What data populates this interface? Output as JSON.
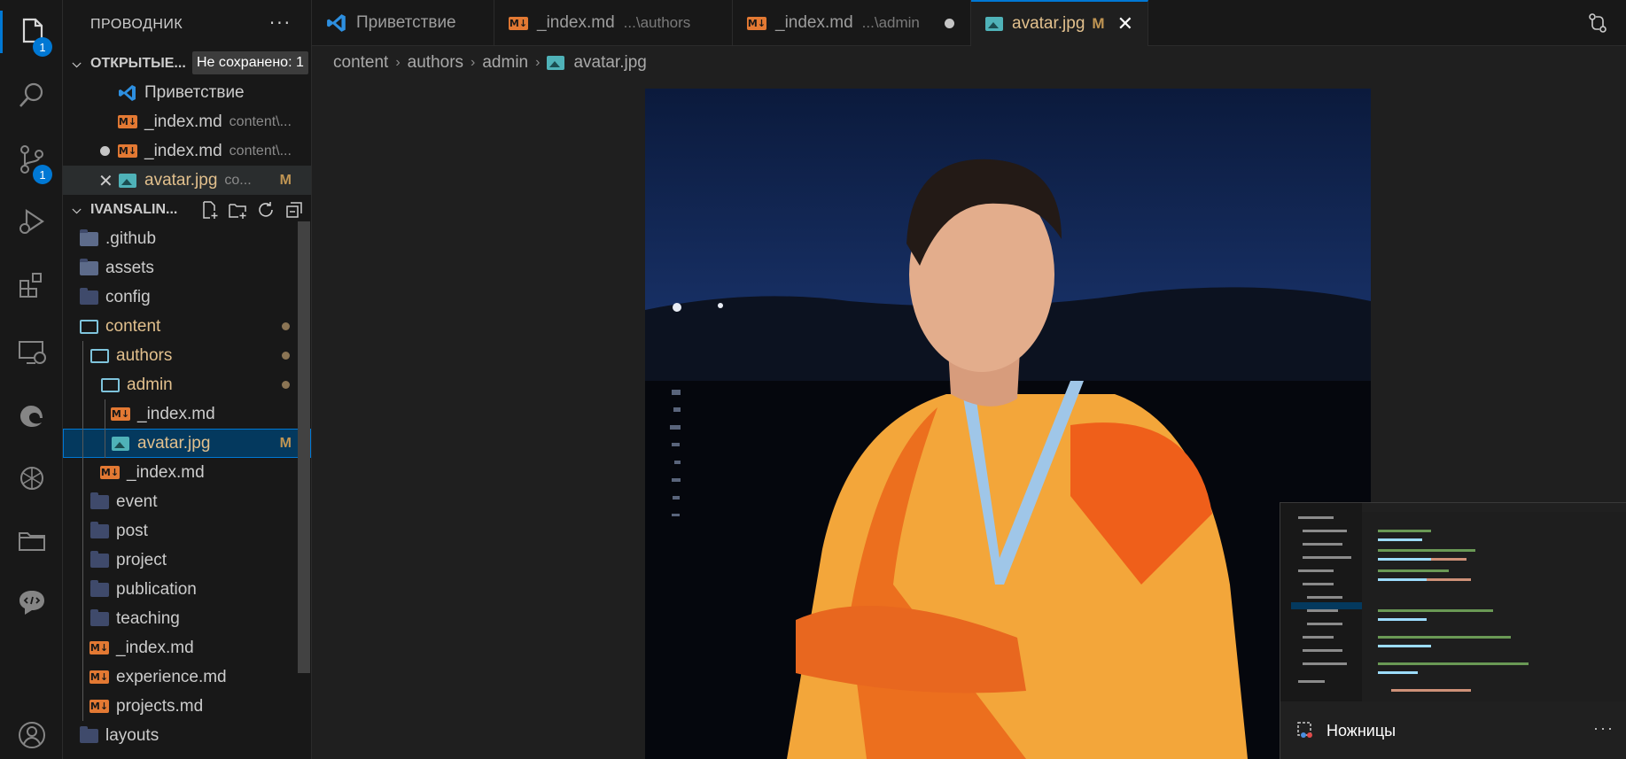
{
  "activity_bar": {
    "explorer_badge": "1",
    "scm_badge": "1"
  },
  "sidebar": {
    "title": "ПРОВОДНИК",
    "more": "···",
    "open_editors": {
      "label": "ОТКРЫТЫЕ...",
      "unsaved_badge": "Не сохранено: 1",
      "items": [
        {
          "name": "Приветствие",
          "desc": ""
        },
        {
          "name": "_index.md",
          "desc": "content\\..."
        },
        {
          "name": "_index.md",
          "desc": "content\\..."
        },
        {
          "name": "avatar.jpg",
          "desc": "co...",
          "status": "M"
        }
      ]
    },
    "project": {
      "label": "IVANSALIN...",
      "tree": [
        {
          "name": ".github"
        },
        {
          "name": "assets"
        },
        {
          "name": "config"
        },
        {
          "name": "content"
        },
        {
          "name": "authors"
        },
        {
          "name": "admin"
        },
        {
          "name": "_index.md"
        },
        {
          "name": "avatar.jpg",
          "status": "M"
        },
        {
          "name": "_index.md"
        },
        {
          "name": "event"
        },
        {
          "name": "post"
        },
        {
          "name": "project"
        },
        {
          "name": "publication"
        },
        {
          "name": "teaching"
        },
        {
          "name": "_index.md"
        },
        {
          "name": "experience.md"
        },
        {
          "name": "projects.md"
        },
        {
          "name": "layouts"
        }
      ]
    }
  },
  "tabs": [
    {
      "label": "Приветствие",
      "desc": ""
    },
    {
      "label": "_index.md",
      "desc": "...\\authors"
    },
    {
      "label": "_index.md",
      "desc": "...\\admin"
    },
    {
      "label": "avatar.jpg",
      "desc": "",
      "status": "M"
    }
  ],
  "breadcrumb": [
    "content",
    "authors",
    "admin",
    "avatar.jpg"
  ],
  "notification": {
    "app": "Ножницы",
    "more": "···"
  },
  "colors": {
    "accent": "#0078d4",
    "modified": "#e2c08d",
    "markdown_icon": "#e37933"
  }
}
